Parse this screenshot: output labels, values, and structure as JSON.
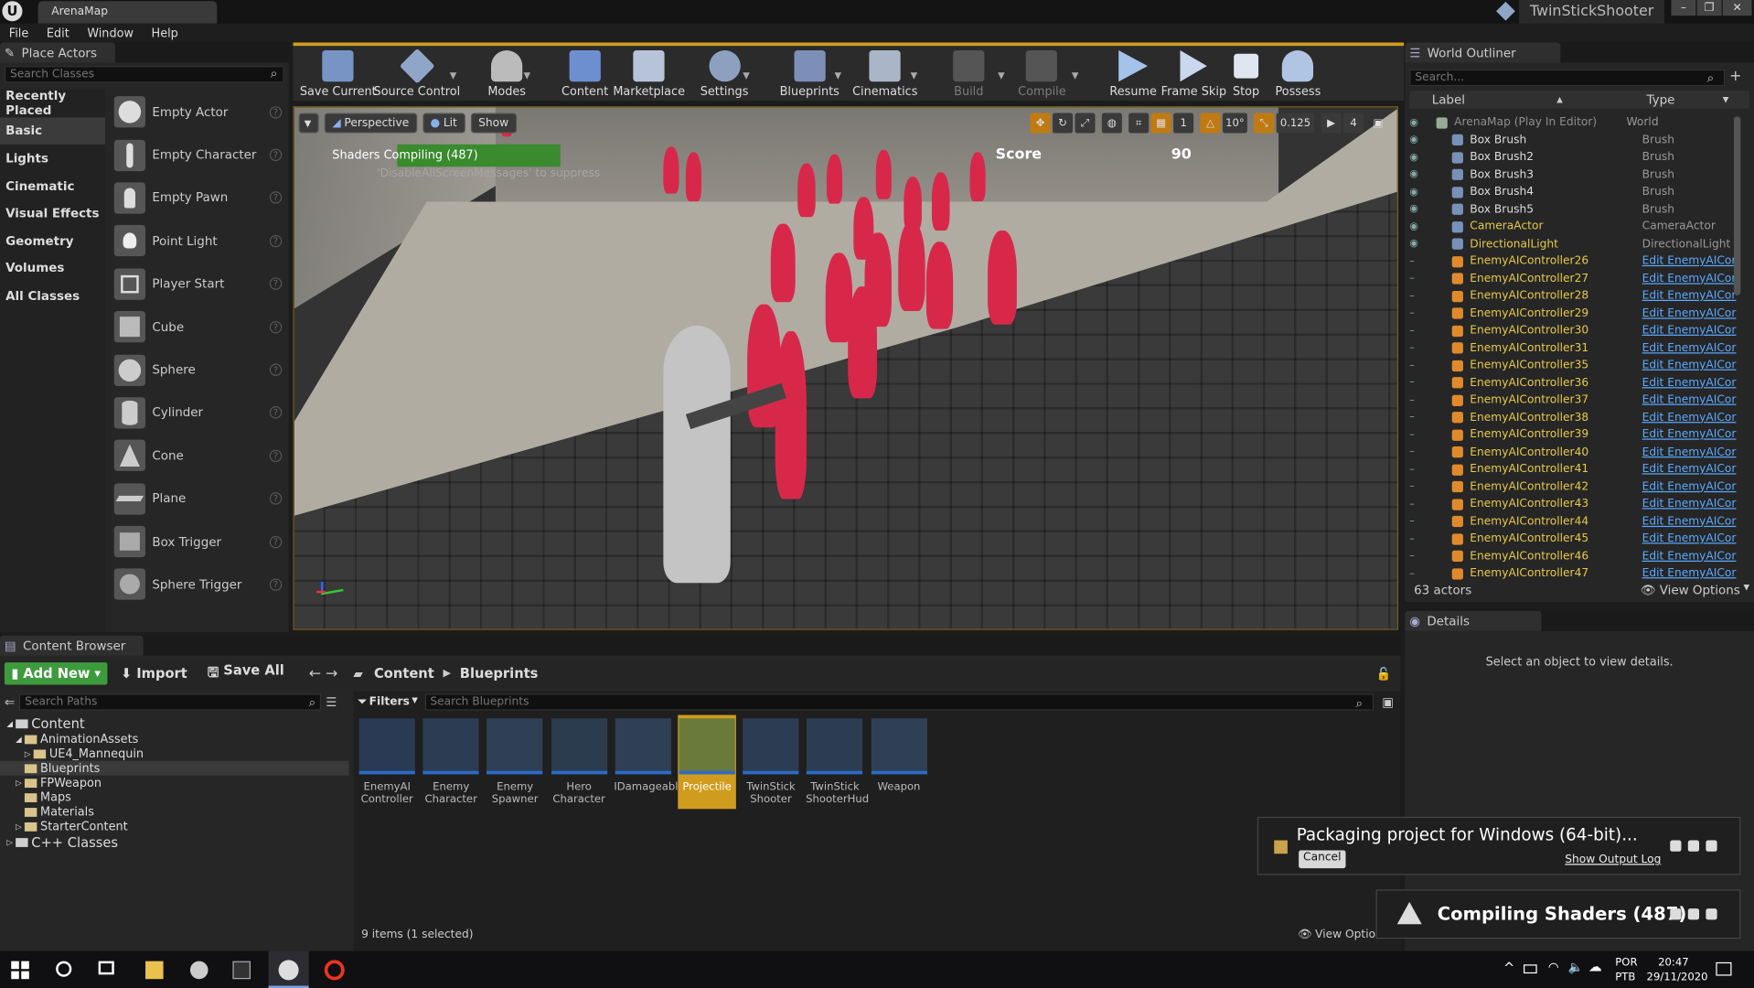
{
  "window": {
    "tab_title": "ArenaMap",
    "project_name": "TwinStickShooter",
    "minimize": "–",
    "maximize": "❐",
    "close": "✕"
  },
  "menu": [
    "File",
    "Edit",
    "Window",
    "Help"
  ],
  "place_actors": {
    "tab_label": "Place Actors",
    "search_placeholder": "Search Classes",
    "categories": [
      "Recently Placed",
      "Basic",
      "Lights",
      "Cinematic",
      "Visual Effects",
      "Geometry",
      "Volumes",
      "All Classes"
    ],
    "selected_category": "Basic",
    "actors": [
      "Empty Actor",
      "Empty Character",
      "Empty Pawn",
      "Point Light",
      "Player Start",
      "Cube",
      "Sphere",
      "Cylinder",
      "Cone",
      "Plane",
      "Box Trigger",
      "Sphere Trigger"
    ]
  },
  "toolbar": [
    "Save Current",
    "Source Control",
    "Modes",
    "Content",
    "Marketplace",
    "Settings",
    "Blueprints",
    "Cinematics",
    "Build",
    "Compile",
    "Resume",
    "Frame Skip",
    "Stop",
    "Possess"
  ],
  "viewport": {
    "perspective": "Perspective",
    "lit": "Lit",
    "show": "Show",
    "shader_msg": "Shaders Compiling (487)",
    "suppress_msg": "'DisableAllScreenMessages' to suppress",
    "score_label": "Score",
    "score_value": "90",
    "grid_size": "1",
    "angle": "10°",
    "scale": "0.125",
    "camera_speed": "4"
  },
  "outliner": {
    "tab_label": "World Outliner",
    "search_placeholder": "Search...",
    "col_label": "Label",
    "col_type": "Type",
    "rows": [
      {
        "label": "ArenaMap (Play In Editor)",
        "type": "World"
      },
      {
        "label": "Box Brush",
        "type": "Brush"
      },
      {
        "label": "Box Brush2",
        "type": "Brush"
      },
      {
        "label": "Box Brush3",
        "type": "Brush"
      },
      {
        "label": "Box Brush4",
        "type": "Brush"
      },
      {
        "label": "Box Brush5",
        "type": "Brush"
      },
      {
        "label": "CameraActor",
        "type": "CameraActor"
      },
      {
        "label": "DirectionalLight",
        "type": "DirectionalLight"
      },
      {
        "label": "EnemyAIController26",
        "type": "Edit EnemyAICor"
      },
      {
        "label": "EnemyAIController27",
        "type": "Edit EnemyAICor"
      },
      {
        "label": "EnemyAIController28",
        "type": "Edit EnemyAICor"
      },
      {
        "label": "EnemyAIController29",
        "type": "Edit EnemyAICor"
      },
      {
        "label": "EnemyAIController30",
        "type": "Edit EnemyAICor"
      },
      {
        "label": "EnemyAIController31",
        "type": "Edit EnemyAICor"
      },
      {
        "label": "EnemyAIController35",
        "type": "Edit EnemyAICor"
      },
      {
        "label": "EnemyAIController36",
        "type": "Edit EnemyAICor"
      },
      {
        "label": "EnemyAIController37",
        "type": "Edit EnemyAICor"
      },
      {
        "label": "EnemyAIController38",
        "type": "Edit EnemyAICor"
      },
      {
        "label": "EnemyAIController39",
        "type": "Edit EnemyAICor"
      },
      {
        "label": "EnemyAIController40",
        "type": "Edit EnemyAICor"
      },
      {
        "label": "EnemyAIController41",
        "type": "Edit EnemyAICor"
      },
      {
        "label": "EnemyAIController42",
        "type": "Edit EnemyAICor"
      },
      {
        "label": "EnemyAIController43",
        "type": "Edit EnemyAICor"
      },
      {
        "label": "EnemyAIController44",
        "type": "Edit EnemyAICor"
      },
      {
        "label": "EnemyAIController45",
        "type": "Edit EnemyAICor"
      },
      {
        "label": "EnemyAIController46",
        "type": "Edit EnemyAICor"
      },
      {
        "label": "EnemyAIController47",
        "type": "Edit EnemyAICor"
      }
    ],
    "actor_count": "63 actors",
    "view_options": "View Options"
  },
  "details": {
    "tab_label": "Details",
    "empty_msg": "Select an object to view details."
  },
  "content_browser": {
    "tab_label": "Content Browser",
    "add_new": "Add New",
    "import": "Import",
    "save_all": "Save All",
    "breadcrumb": [
      "Content",
      "Blueprints"
    ],
    "search_paths_placeholder": "Search Paths",
    "filters": "Filters",
    "search_assets_placeholder": "Search Blueprints",
    "tree": [
      {
        "label": "Content",
        "level": 0
      },
      {
        "label": "AnimationAssets",
        "level": 1
      },
      {
        "label": "UE4_Mannequin",
        "level": 2
      },
      {
        "label": "Blueprints",
        "level": 1
      },
      {
        "label": "FPWeapon",
        "level": 1
      },
      {
        "label": "Maps",
        "level": 1
      },
      {
        "label": "Materials",
        "level": 1
      },
      {
        "label": "StarterContent",
        "level": 1
      },
      {
        "label": "C++ Classes",
        "level": 0
      }
    ],
    "assets": [
      "EnemyAI Controller",
      "Enemy Character",
      "Enemy Spawner",
      "Hero Character",
      "IDamageable",
      "Projectile",
      "TwinStick Shooter",
      "TwinStick ShooterHud",
      "Weapon"
    ],
    "selected_asset": "Projectile",
    "status": "9 items (1 selected)",
    "view_options": "View Options"
  },
  "notifications": {
    "packaging": "Packaging project for Windows (64-bit)...",
    "cancel": "Cancel",
    "show_output_log": "Show Output Log",
    "compiling": "Compiling Shaders (487)"
  },
  "taskbar": {
    "lang1": "POR",
    "lang2": "PTB",
    "time": "20:47",
    "date": "29/11/2020"
  },
  "colors": {
    "accent": "#d09c1e",
    "enemy": "#d8284a",
    "add_new": "#3d9a3d",
    "link": "#5aa9ff",
    "progress": "#3a8a2e"
  }
}
